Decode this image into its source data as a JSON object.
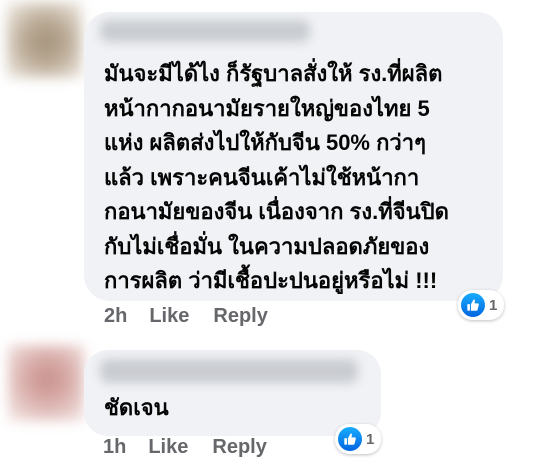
{
  "comments": [
    {
      "author": "",
      "text_lines": [
        "มันจะมีได้ไง ก็รัฐบาลสั่งให้ รง.ที่ผลิต",
        "หน้ากากอนามัยรายใหญ่ของไทย 5",
        "แห่ง ผลิตส่งไปให้กับจีน 50% กว่าๆ",
        "แล้ว เพราะคนจีนเค้าไม่ใช้หน้ากา",
        "กอนามัยของจีน เนื่องจาก รง.ที่จีนปิด",
        "กับไม่เชื่อมั่น ในความปลอดภัยของ",
        "การผลิต ว่ามีเชื้อปะปนอยู่หรือไม่ !!!"
      ],
      "timestamp": "2h",
      "like_label": "Like",
      "reply_label": "Reply",
      "reaction_count": "1",
      "reaction_icon": "like-icon"
    },
    {
      "author": "",
      "text_lines": [
        "ชัดเจน"
      ],
      "timestamp": "1h",
      "like_label": "Like",
      "reply_label": "Reply",
      "reaction_count": "1",
      "reaction_icon": "like-icon"
    }
  ],
  "colors": {
    "bubble_background": "#f0f2f5",
    "secondary_text": "#65676b",
    "primary_text": "#050505",
    "like_blue": "#1877f2"
  }
}
